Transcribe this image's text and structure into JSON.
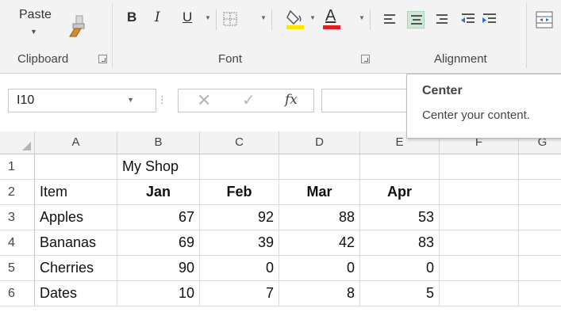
{
  "ribbon": {
    "clipboard": {
      "paste_label": "Paste",
      "group_label": "Clipboard"
    },
    "font": {
      "group_label": "Font",
      "bold": "B",
      "italic": "I",
      "underline": "U",
      "font_color_letter": "A",
      "font_color": "#e02020",
      "fill_color": "#ffe600"
    },
    "alignment": {
      "group_label": "Alignment",
      "selected": "Center"
    }
  },
  "formula_bar": {
    "name_box": "I10",
    "cancel_glyph": "✕",
    "enter_glyph": "✓",
    "fx_label": "fx",
    "content": ""
  },
  "tooltip": {
    "title": "Center",
    "description": "Center your content."
  },
  "sheet": {
    "columns": [
      "A",
      "B",
      "C",
      "D",
      "E",
      "F",
      "G"
    ],
    "rows": [
      {
        "num": "1",
        "cells": [
          "",
          "My Shop",
          "",
          "",
          "",
          "",
          ""
        ]
      },
      {
        "num": "2",
        "cells": [
          "Item",
          "Jan",
          "Feb",
          "Mar",
          "Apr",
          "",
          ""
        ]
      },
      {
        "num": "3",
        "cells": [
          "Apples",
          "67",
          "92",
          "88",
          "53",
          "",
          ""
        ]
      },
      {
        "num": "4",
        "cells": [
          "Bananas",
          "69",
          "39",
          "42",
          "83",
          "",
          ""
        ]
      },
      {
        "num": "5",
        "cells": [
          "Cherries",
          "90",
          "0",
          "0",
          "0",
          "",
          ""
        ]
      },
      {
        "num": "6",
        "cells": [
          "Dates",
          "10",
          "7",
          "8",
          "5",
          "",
          ""
        ]
      }
    ]
  }
}
